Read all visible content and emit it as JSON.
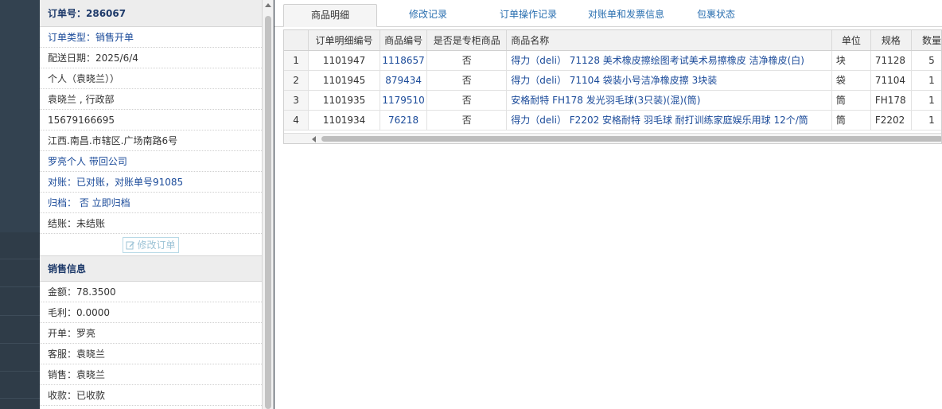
{
  "order": {
    "order_no_label": "订单号：286067",
    "rows": [
      {
        "text": "订单类型：销售开单",
        "style": "blue"
      },
      {
        "text": "配送日期：2025/6/4",
        "style": ""
      },
      {
        "text": "个人（袁晓兰））",
        "style": ""
      },
      {
        "text": "袁晓兰 , 行政部",
        "style": ""
      },
      {
        "text": "15679166695",
        "style": ""
      },
      {
        "text": "江西.南昌.市辖区.广场南路6号",
        "style": ""
      },
      {
        "text": "罗亮个人 带回公司",
        "style": "blue"
      },
      {
        "text": "对账：已对账，对账单号91085",
        "style": "blue"
      },
      {
        "text": "归档：  否 立即归档",
        "style": "blue"
      },
      {
        "text": "结账：未结账",
        "style": ""
      }
    ],
    "edit_button_label": "修改订单"
  },
  "sales": {
    "title": "销售信息",
    "rows": [
      "金额：78.3500",
      "毛利：0.0000",
      "开单：罗亮",
      "客服：袁晓兰",
      "销售：袁晓兰",
      "收款：已收款"
    ]
  },
  "tabs": [
    {
      "label": "商品明细",
      "active": true
    },
    {
      "label": "修改记录",
      "active": false
    },
    {
      "label": "订单操作记录",
      "active": false
    },
    {
      "label": "对账单和发票信息",
      "active": false
    },
    {
      "label": "包裹状态",
      "active": false
    }
  ],
  "grid": {
    "columns": [
      "",
      "订单明细编号",
      "商品编号",
      "是否是专柜商品",
      "商品名称",
      "单位",
      "规格",
      "数量"
    ],
    "rows": [
      [
        "1",
        "1101947",
        "1118657",
        "否",
        "得力（deli） 71128 美术橡皮擦绘图考试美术易擦橡皮 洁净橡皮(白)",
        "块",
        "71128",
        "5"
      ],
      [
        "2",
        "1101945",
        "879434",
        "否",
        "得力（deli） 71104 袋装小号洁净橡皮擦 3块装",
        "袋",
        "71104",
        "1"
      ],
      [
        "3",
        "1101935",
        "1179510",
        "否",
        "安格耐特 FH178 发光羽毛球(3只装)(混)(筒)",
        "筒",
        "FH178",
        "1"
      ],
      [
        "4",
        "1101934",
        "76218",
        "否",
        "得力（deli） F2202 安格耐特 羽毛球 耐打训练家庭娱乐用球 12个/筒",
        "筒",
        "F2202",
        "1"
      ]
    ]
  }
}
